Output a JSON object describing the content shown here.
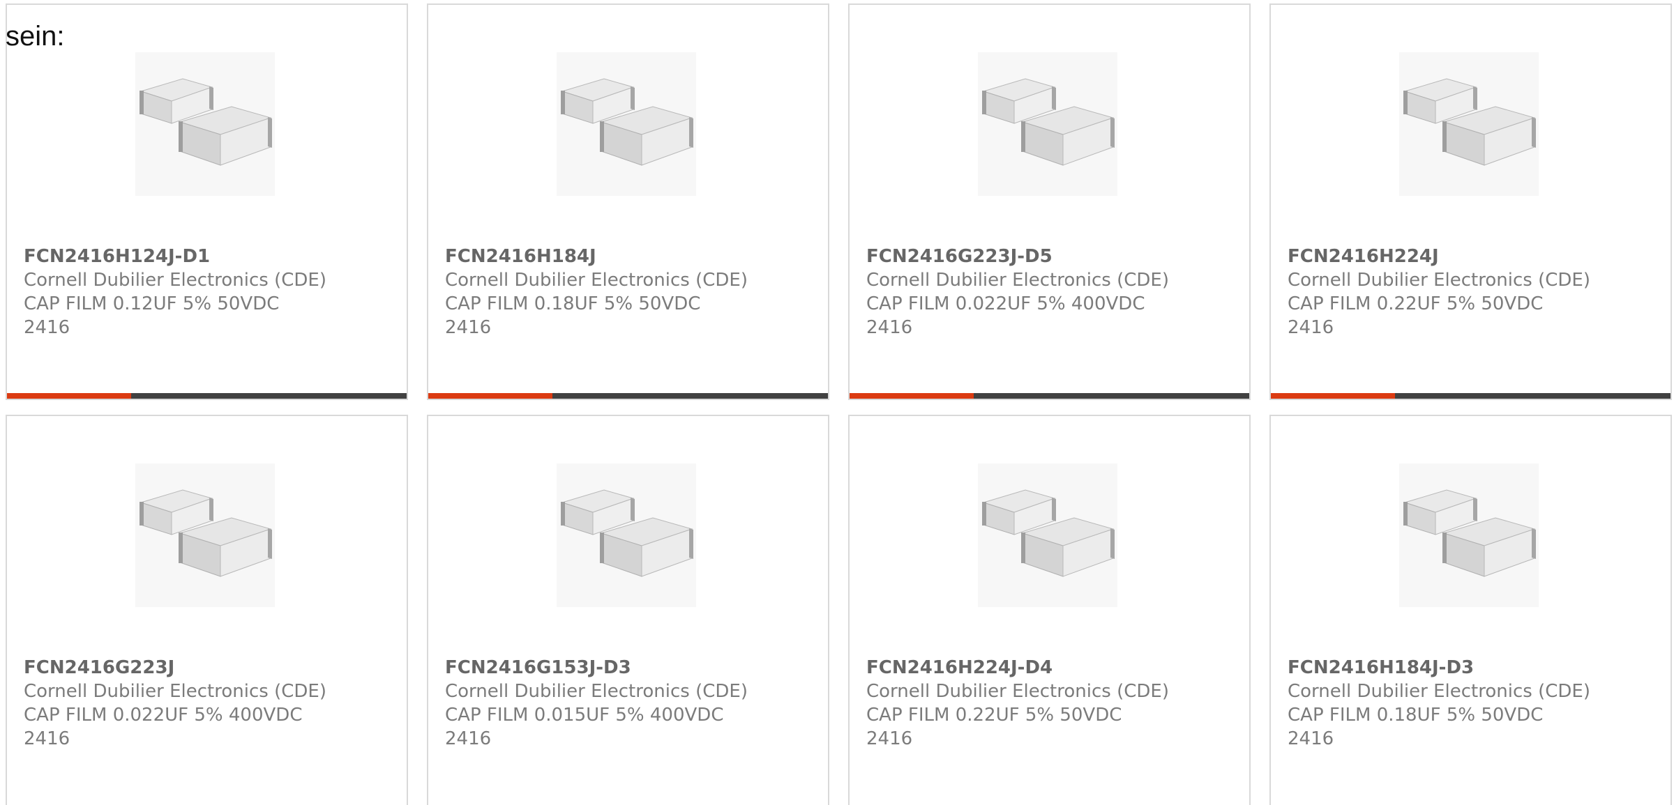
{
  "intro_text": "sein:",
  "colors": {
    "accent": "#db3b12",
    "bar_track": "#414141",
    "card_border": "#d9d9d9",
    "text_muted": "#7b7b7b",
    "text_bold": "#666666"
  },
  "products": [
    {
      "part_number": "FCN2416H124J-D1",
      "manufacturer": "Cornell Dubilier Electronics (CDE)",
      "description": "CAP FILM 0.12UF 5% 50VDC",
      "package": "2416",
      "image_icon": "capacitor-image",
      "progress_fraction": 0.31
    },
    {
      "part_number": "FCN2416H184J",
      "manufacturer": "Cornell Dubilier Electronics (CDE)",
      "description": "CAP FILM 0.18UF 5% 50VDC",
      "package": "2416",
      "image_icon": "capacitor-image",
      "progress_fraction": 0.31
    },
    {
      "part_number": "FCN2416G223J-D5",
      "manufacturer": "Cornell Dubilier Electronics (CDE)",
      "description": "CAP FILM 0.022UF 5% 400VDC",
      "package": "2416",
      "image_icon": "capacitor-image",
      "progress_fraction": 0.31
    },
    {
      "part_number": "FCN2416H224J",
      "manufacturer": "Cornell Dubilier Electronics (CDE)",
      "description": "CAP FILM 0.22UF 5% 50VDC",
      "package": "2416",
      "image_icon": "capacitor-image",
      "progress_fraction": 0.31
    },
    {
      "part_number": "FCN2416G223J",
      "manufacturer": "Cornell Dubilier Electronics (CDE)",
      "description": "CAP FILM 0.022UF 5% 400VDC",
      "package": "2416",
      "image_icon": "capacitor-image"
    },
    {
      "part_number": "FCN2416G153J-D3",
      "manufacturer": "Cornell Dubilier Electronics (CDE)",
      "description": "CAP FILM 0.015UF 5% 400VDC",
      "package": "2416",
      "image_icon": "capacitor-image"
    },
    {
      "part_number": "FCN2416H224J-D4",
      "manufacturer": "Cornell Dubilier Electronics (CDE)",
      "description": "CAP FILM 0.22UF 5% 50VDC",
      "package": "2416",
      "image_icon": "capacitor-image"
    },
    {
      "part_number": "FCN2416H184J-D3",
      "manufacturer": "Cornell Dubilier Electronics (CDE)",
      "description": "CAP FILM 0.18UF 5% 50VDC",
      "package": "2416",
      "image_icon": "capacitor-image"
    }
  ]
}
